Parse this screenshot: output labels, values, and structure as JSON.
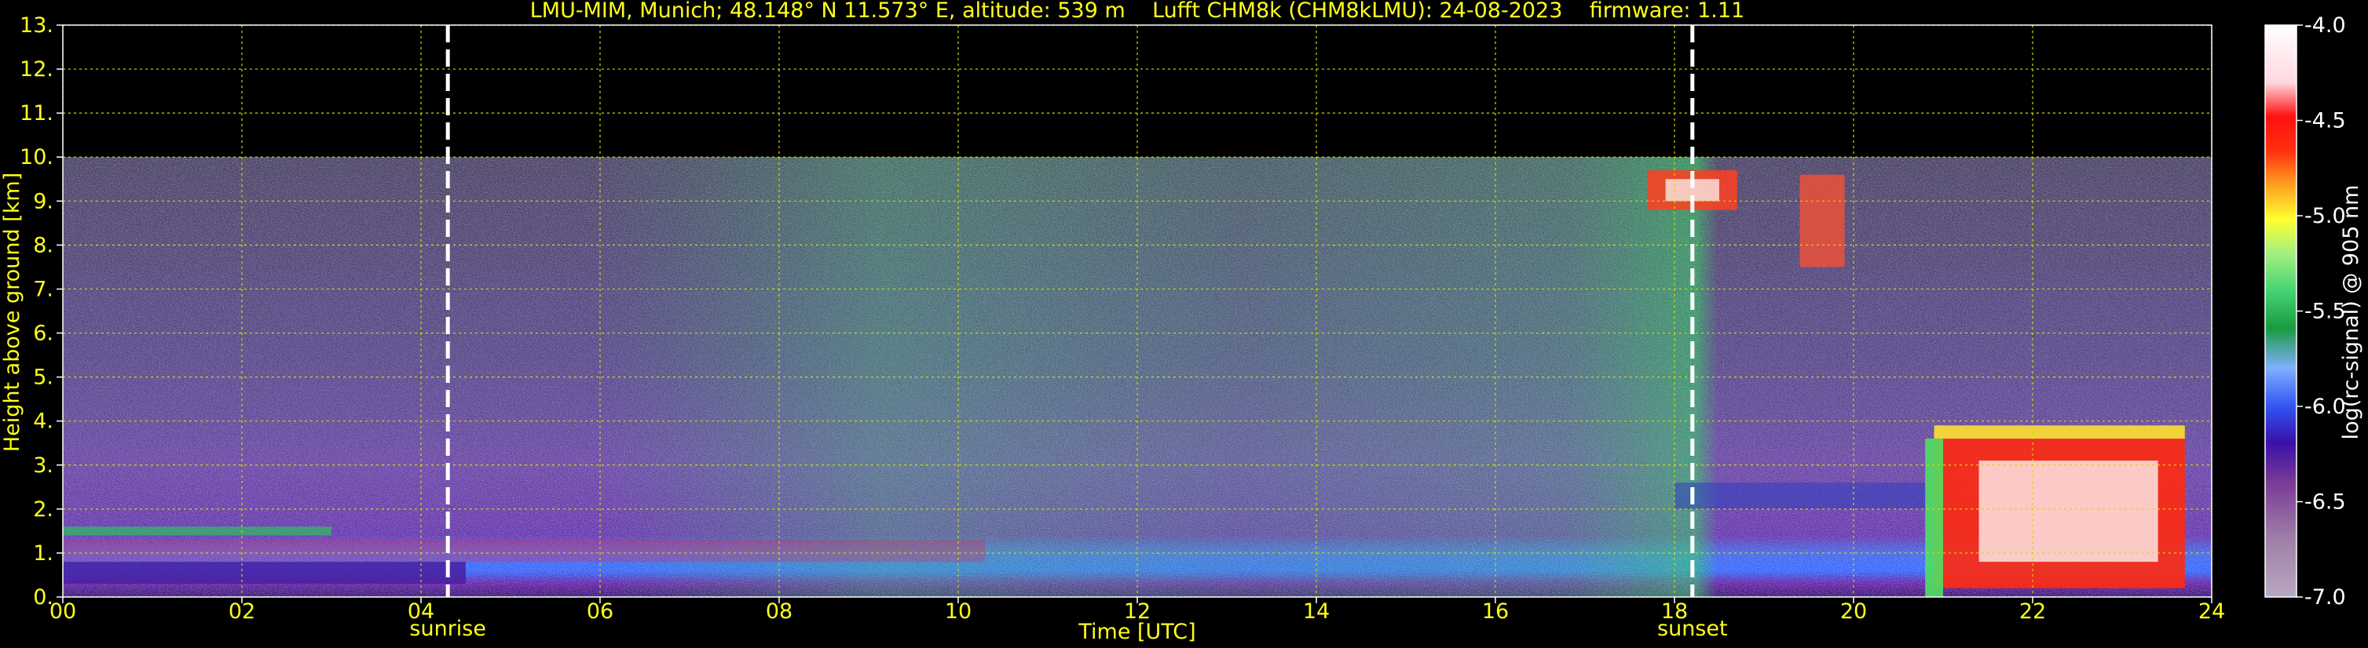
{
  "chart_data": {
    "type": "heatmap",
    "title": "LMU-MIM, Munich; 48.148° N 11.573° E, altitude: 539 m    Lufft CHM8k (CHM8kLMU): 24-08-2023    firmware: 1.11",
    "xlabel": "Time [UTC]",
    "ylabel": "Height above ground [km]",
    "colorbar_label": "log(rc-signal) @ 905 nm",
    "xlim": [
      0,
      24
    ],
    "ylim": [
      0,
      13
    ],
    "x_ticks": [
      0,
      2,
      4,
      6,
      8,
      10,
      12,
      14,
      16,
      18,
      20,
      22,
      24
    ],
    "x_tick_labels": [
      "00",
      "02",
      "04",
      "06",
      "08",
      "10",
      "12",
      "14",
      "16",
      "18",
      "20",
      "22",
      "24"
    ],
    "y_ticks": [
      0,
      1,
      2,
      3,
      4,
      5,
      6,
      7,
      8,
      9,
      10,
      11,
      12,
      13
    ],
    "y_tick_labels": [
      "0.",
      "1.",
      "2.",
      "3.",
      "4.",
      "5.",
      "6.",
      "7.",
      "8.",
      "9.",
      "10.",
      "11.",
      "12.",
      "13."
    ],
    "grid": true,
    "data_top_km": 10,
    "colorbar_range": [
      -7.0,
      -4.0
    ],
    "colorbar_ticks": [
      -7.0,
      -6.5,
      -6.0,
      -5.5,
      -5.0,
      -4.5,
      -4.0
    ],
    "colorbar_tick_labels": [
      "-7.0",
      "-6.5",
      "-6.0",
      "-5.5",
      "-5.0",
      "-4.5",
      "-4.0"
    ],
    "sun_events": [
      {
        "name": "sunrise",
        "time": 4.3
      },
      {
        "name": "sunset",
        "time": 18.2
      }
    ],
    "colors": {
      "text": "#ffff1a",
      "grid": "#d8d800",
      "event_line": "#ffffff",
      "background": "#000000"
    }
  }
}
